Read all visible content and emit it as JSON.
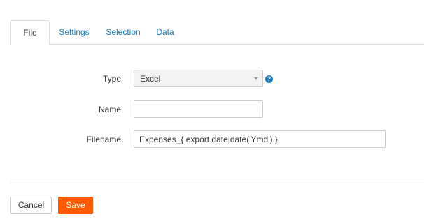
{
  "tabs": {
    "file": "File",
    "settings": "Settings",
    "selection": "Selection",
    "data": "Data"
  },
  "form": {
    "type_label": "Type",
    "type_value": "Excel",
    "help_symbol": "?",
    "name_label": "Name",
    "name_value": "",
    "filename_label": "Filename",
    "filename_value": "Expenses_{ export.date|date('Ymd') }"
  },
  "buttons": {
    "cancel": "Cancel",
    "save": "Save"
  },
  "colors": {
    "accent": "#1a7bbd",
    "save_button": "#ff5a00"
  },
  "icons": {
    "help": "help-circle-icon",
    "dropdown": "chevron-down-icon"
  }
}
